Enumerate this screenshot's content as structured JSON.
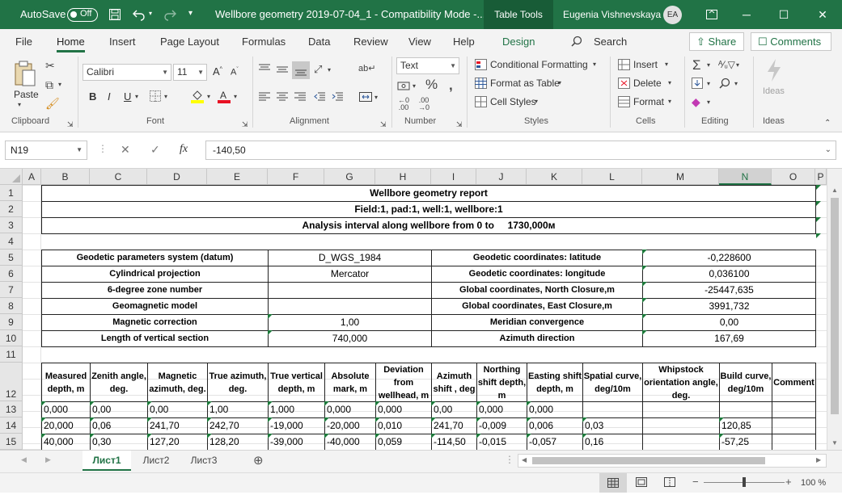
{
  "titlebar": {
    "autosave_label": "AutoSave",
    "autosave_state": "Off",
    "title": "Wellbore geometry 2019-07-04_1  -  Compatibility Mode  -...",
    "table_tools": "Table Tools",
    "user_name": "Eugenia Vishnevskaya",
    "user_initials": "EA"
  },
  "ribbon_tabs": [
    {
      "label": "File",
      "active": false
    },
    {
      "label": "Home",
      "active": true
    },
    {
      "label": "Insert",
      "active": false
    },
    {
      "label": "Page Layout",
      "active": false
    },
    {
      "label": "Formulas",
      "active": false
    },
    {
      "label": "Data",
      "active": false
    },
    {
      "label": "Review",
      "active": false
    },
    {
      "label": "View",
      "active": false
    },
    {
      "label": "Help",
      "active": false
    },
    {
      "label": "Design",
      "active": false,
      "green": true
    }
  ],
  "search_label": "Search",
  "share_label": "Share",
  "comments_label": "Comments",
  "ribbon": {
    "clipboard": {
      "paste": "Paste",
      "group": "Clipboard"
    },
    "font": {
      "name": "Calibri",
      "size": "11",
      "group": "Font",
      "bold": "B",
      "italic": "I",
      "underline": "U"
    },
    "alignment": {
      "group": "Alignment"
    },
    "number": {
      "format": "Text",
      "group": "Number"
    },
    "styles": {
      "cond": "Conditional Formatting",
      "table": "Format as Table",
      "cell": "Cell Styles",
      "group": "Styles"
    },
    "cells": {
      "insert": "Insert",
      "delete": "Delete",
      "format": "Format",
      "group": "Cells"
    },
    "editing": {
      "group": "Editing"
    },
    "ideas": {
      "label": "Ideas",
      "group": "Ideas"
    }
  },
  "formula_bar": {
    "name_box": "N19",
    "fx": "fx",
    "value": "-140,50"
  },
  "columns": [
    "A",
    "B",
    "C",
    "D",
    "E",
    "F",
    "G",
    "H",
    "I",
    "J",
    "K",
    "L",
    "M",
    "N",
    "O",
    "P"
  ],
  "row_numbers": [
    "1",
    "2",
    "3",
    "4",
    "5",
    "6",
    "7",
    "8",
    "9",
    "10",
    "11",
    "12",
    "13",
    "14",
    "15"
  ],
  "report": {
    "title": "Wellbore geometry report",
    "field": "Field:1, pad:1, well:1, wellbore:1",
    "interval": "Analysis interval along wellbore from 0 to     1730,000м"
  },
  "params": [
    {
      "label": "Geodetic parameters system (datum)",
      "value": "D_WGS_1984",
      "label2": "Geodetic coordinates: latitude",
      "value2": "-0,228600"
    },
    {
      "label": "Cylindrical projection",
      "value": "Mercator",
      "label2": "Geodetic coordinates: longitude",
      "value2": "0,036100"
    },
    {
      "label": "6-degree zone number",
      "value": "",
      "label2": "Global coordinates, North Closure,m",
      "value2": "-25447,635"
    },
    {
      "label": "Geomagnetic model",
      "value": "",
      "label2": "Global coordinates, East Closure,m",
      "value2": "3991,732"
    },
    {
      "label": "Magnetic correction",
      "value": "1,00",
      "label2": "Meridian convergence",
      "value2": "0,00"
    },
    {
      "label": "Length of vertical section",
      "value": "740,000",
      "label2": "Azimuth direction",
      "value2": "167,69"
    }
  ],
  "headers": [
    "Measured depth, m",
    "Zenith angle, deg.",
    "Magnetic azimuth, deg.",
    "True azimuth, deg.",
    "True vertical depth, m",
    "Absolute mark, m",
    "Deviation from wellhead, m",
    "Azimuth shift , deg",
    "Northing shift depth, m",
    "Easting shift depth, m",
    "Spatial curve, deg/10m",
    "Whipstock orientation angle, deg.",
    "Build curve, deg/10m",
    "Comment"
  ],
  "data_rows": [
    [
      "0,000",
      "0,00",
      "0,00",
      "1,00",
      "1,000",
      "0,000",
      "0,000",
      "0,00",
      "0,000",
      "0,000",
      "",
      "",
      "",
      ""
    ],
    [
      "20,000",
      "0,06",
      "241,70",
      "242,70",
      "-19,000",
      "-20,000",
      "0,010",
      "241,70",
      "-0,009",
      "0,006",
      "0,03",
      "",
      "120,85",
      ""
    ],
    [
      "40,000",
      "0,30",
      "127,20",
      "128,20",
      "-39,000",
      "-40,000",
      "0,059",
      "-114,50",
      "-0,015",
      "-0,057",
      "0,16",
      "",
      "-57,25",
      ""
    ]
  ],
  "sheets": [
    {
      "label": "Лист1",
      "active": true
    },
    {
      "label": "Лист2",
      "active": false
    },
    {
      "label": "Лист3",
      "active": false
    }
  ],
  "zoom": "100 %"
}
